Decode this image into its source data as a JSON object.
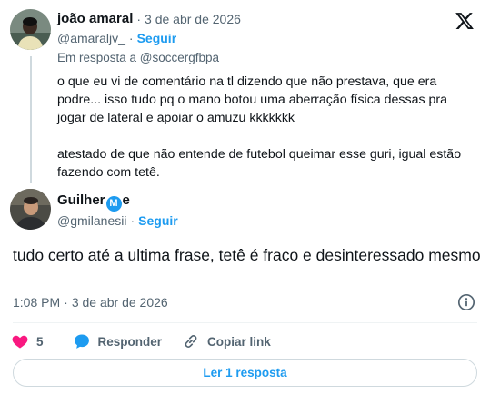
{
  "parent_tweet": {
    "author_name": "joão amaral",
    "timestamp": "3 de abr de 2026",
    "handle": "@amaraljv_",
    "follow_label": "Seguir",
    "reply_to_prefix": "Em resposta a ",
    "reply_to_handle": "@soccergfbpa",
    "paragraphs": [
      "o que eu vi de comentário na tl dizendo que não prestava, que era podre... isso tudo pq o mano botou uma aberração física dessas pra jogar de lateral e apoiar o amuzu kkkkkkk",
      "atestado de que não entende de futebol queimar esse guri, igual estão fazendo com tetê."
    ]
  },
  "main_tweet": {
    "author_name_pre": "Guilher",
    "author_name_badge": "M",
    "author_name_post": "e",
    "handle": "@gmilanesii",
    "follow_label": "Seguir",
    "text": "tudo certo até a ultima frase, tetê é fraco e desinteressado mesmo",
    "time": "1:08 PM",
    "date": "3 de abr de 2026"
  },
  "actions": {
    "like_count": "5",
    "reply_label": "Responder",
    "copy_link_label": "Copiar link"
  },
  "load_more_label": "Ler 1 resposta",
  "colors": {
    "accent": "#1d9bf0",
    "like": "#f91880",
    "muted": "#536471",
    "text": "#0f1419",
    "border": "#cfd9de"
  },
  "icons": [
    "x-logo-icon",
    "info-icon",
    "heart-icon",
    "reply-bubble-icon",
    "link-icon"
  ]
}
